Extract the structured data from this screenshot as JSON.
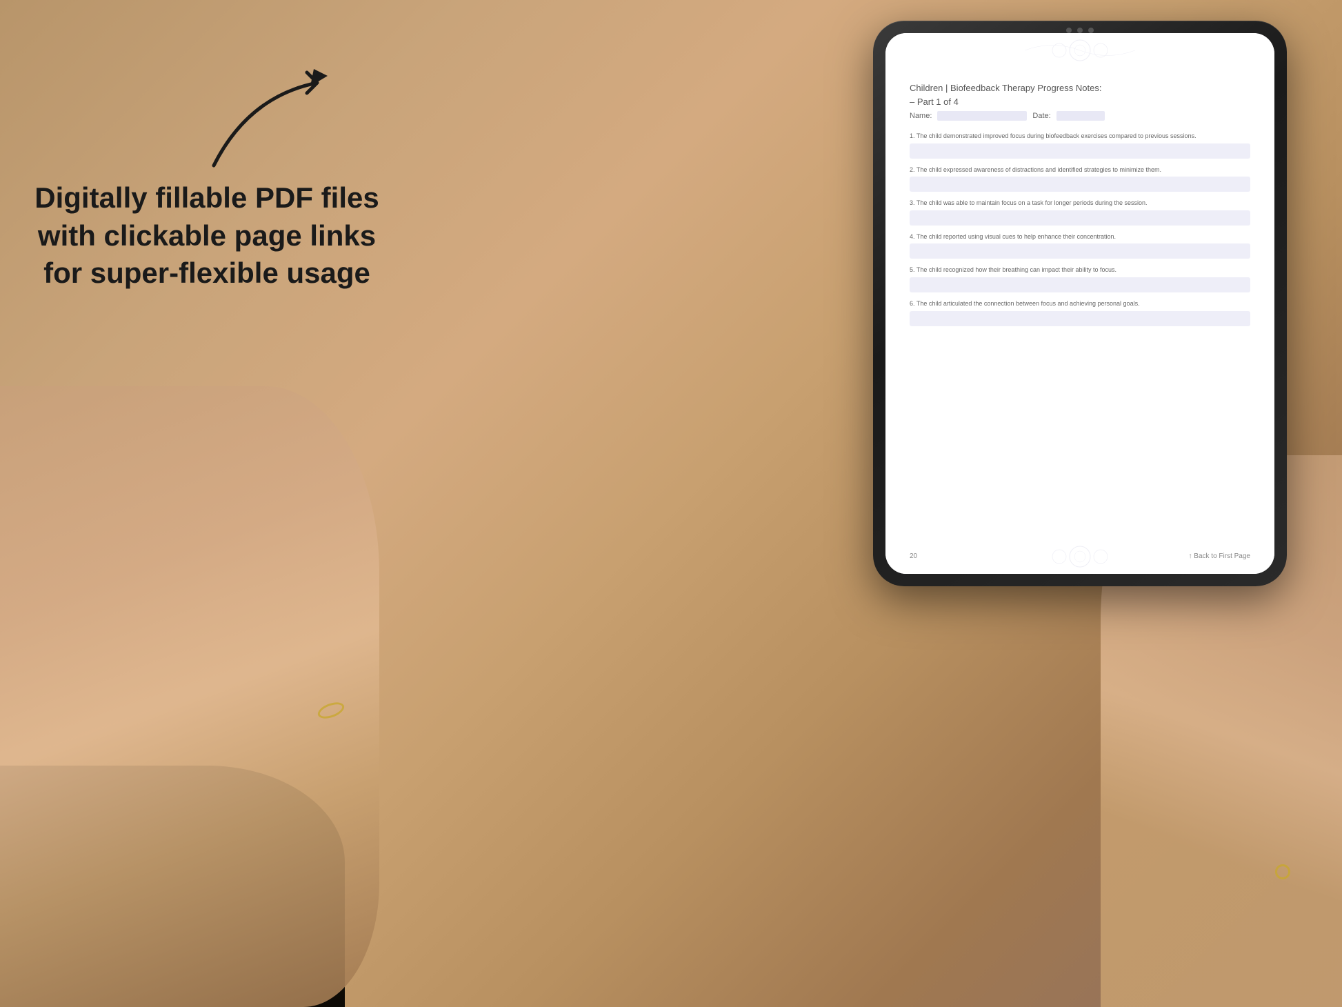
{
  "background": {
    "description": "Warm beige/tan background with hands holding tablet"
  },
  "promo": {
    "text": "Digitally fillable PDF files with clickable page links for super-flexible usage"
  },
  "tablet": {
    "title_line1": "Children | Biofeedback Therapy Progress Notes:",
    "title_line2": "– Part 1 of 4",
    "name_label": "Name:",
    "date_label": "Date:",
    "items": [
      {
        "number": "1.",
        "text": "The child demonstrated improved focus during biofeedback exercises compared to previous sessions."
      },
      {
        "number": "2.",
        "text": "The child expressed awareness of distractions and identified strategies to minimize them."
      },
      {
        "number": "3.",
        "text": "The child was able to maintain focus on a task for longer periods during the session."
      },
      {
        "number": "4.",
        "text": "The child reported using visual cues to help enhance their concentration."
      },
      {
        "number": "5.",
        "text": "The child recognized how their breathing can impact their ability to focus."
      },
      {
        "number": "6.",
        "text": "The child articulated the connection between focus and achieving personal goals."
      }
    ],
    "footer": {
      "page_number": "20",
      "back_link": "↑ Back to First Page"
    }
  }
}
